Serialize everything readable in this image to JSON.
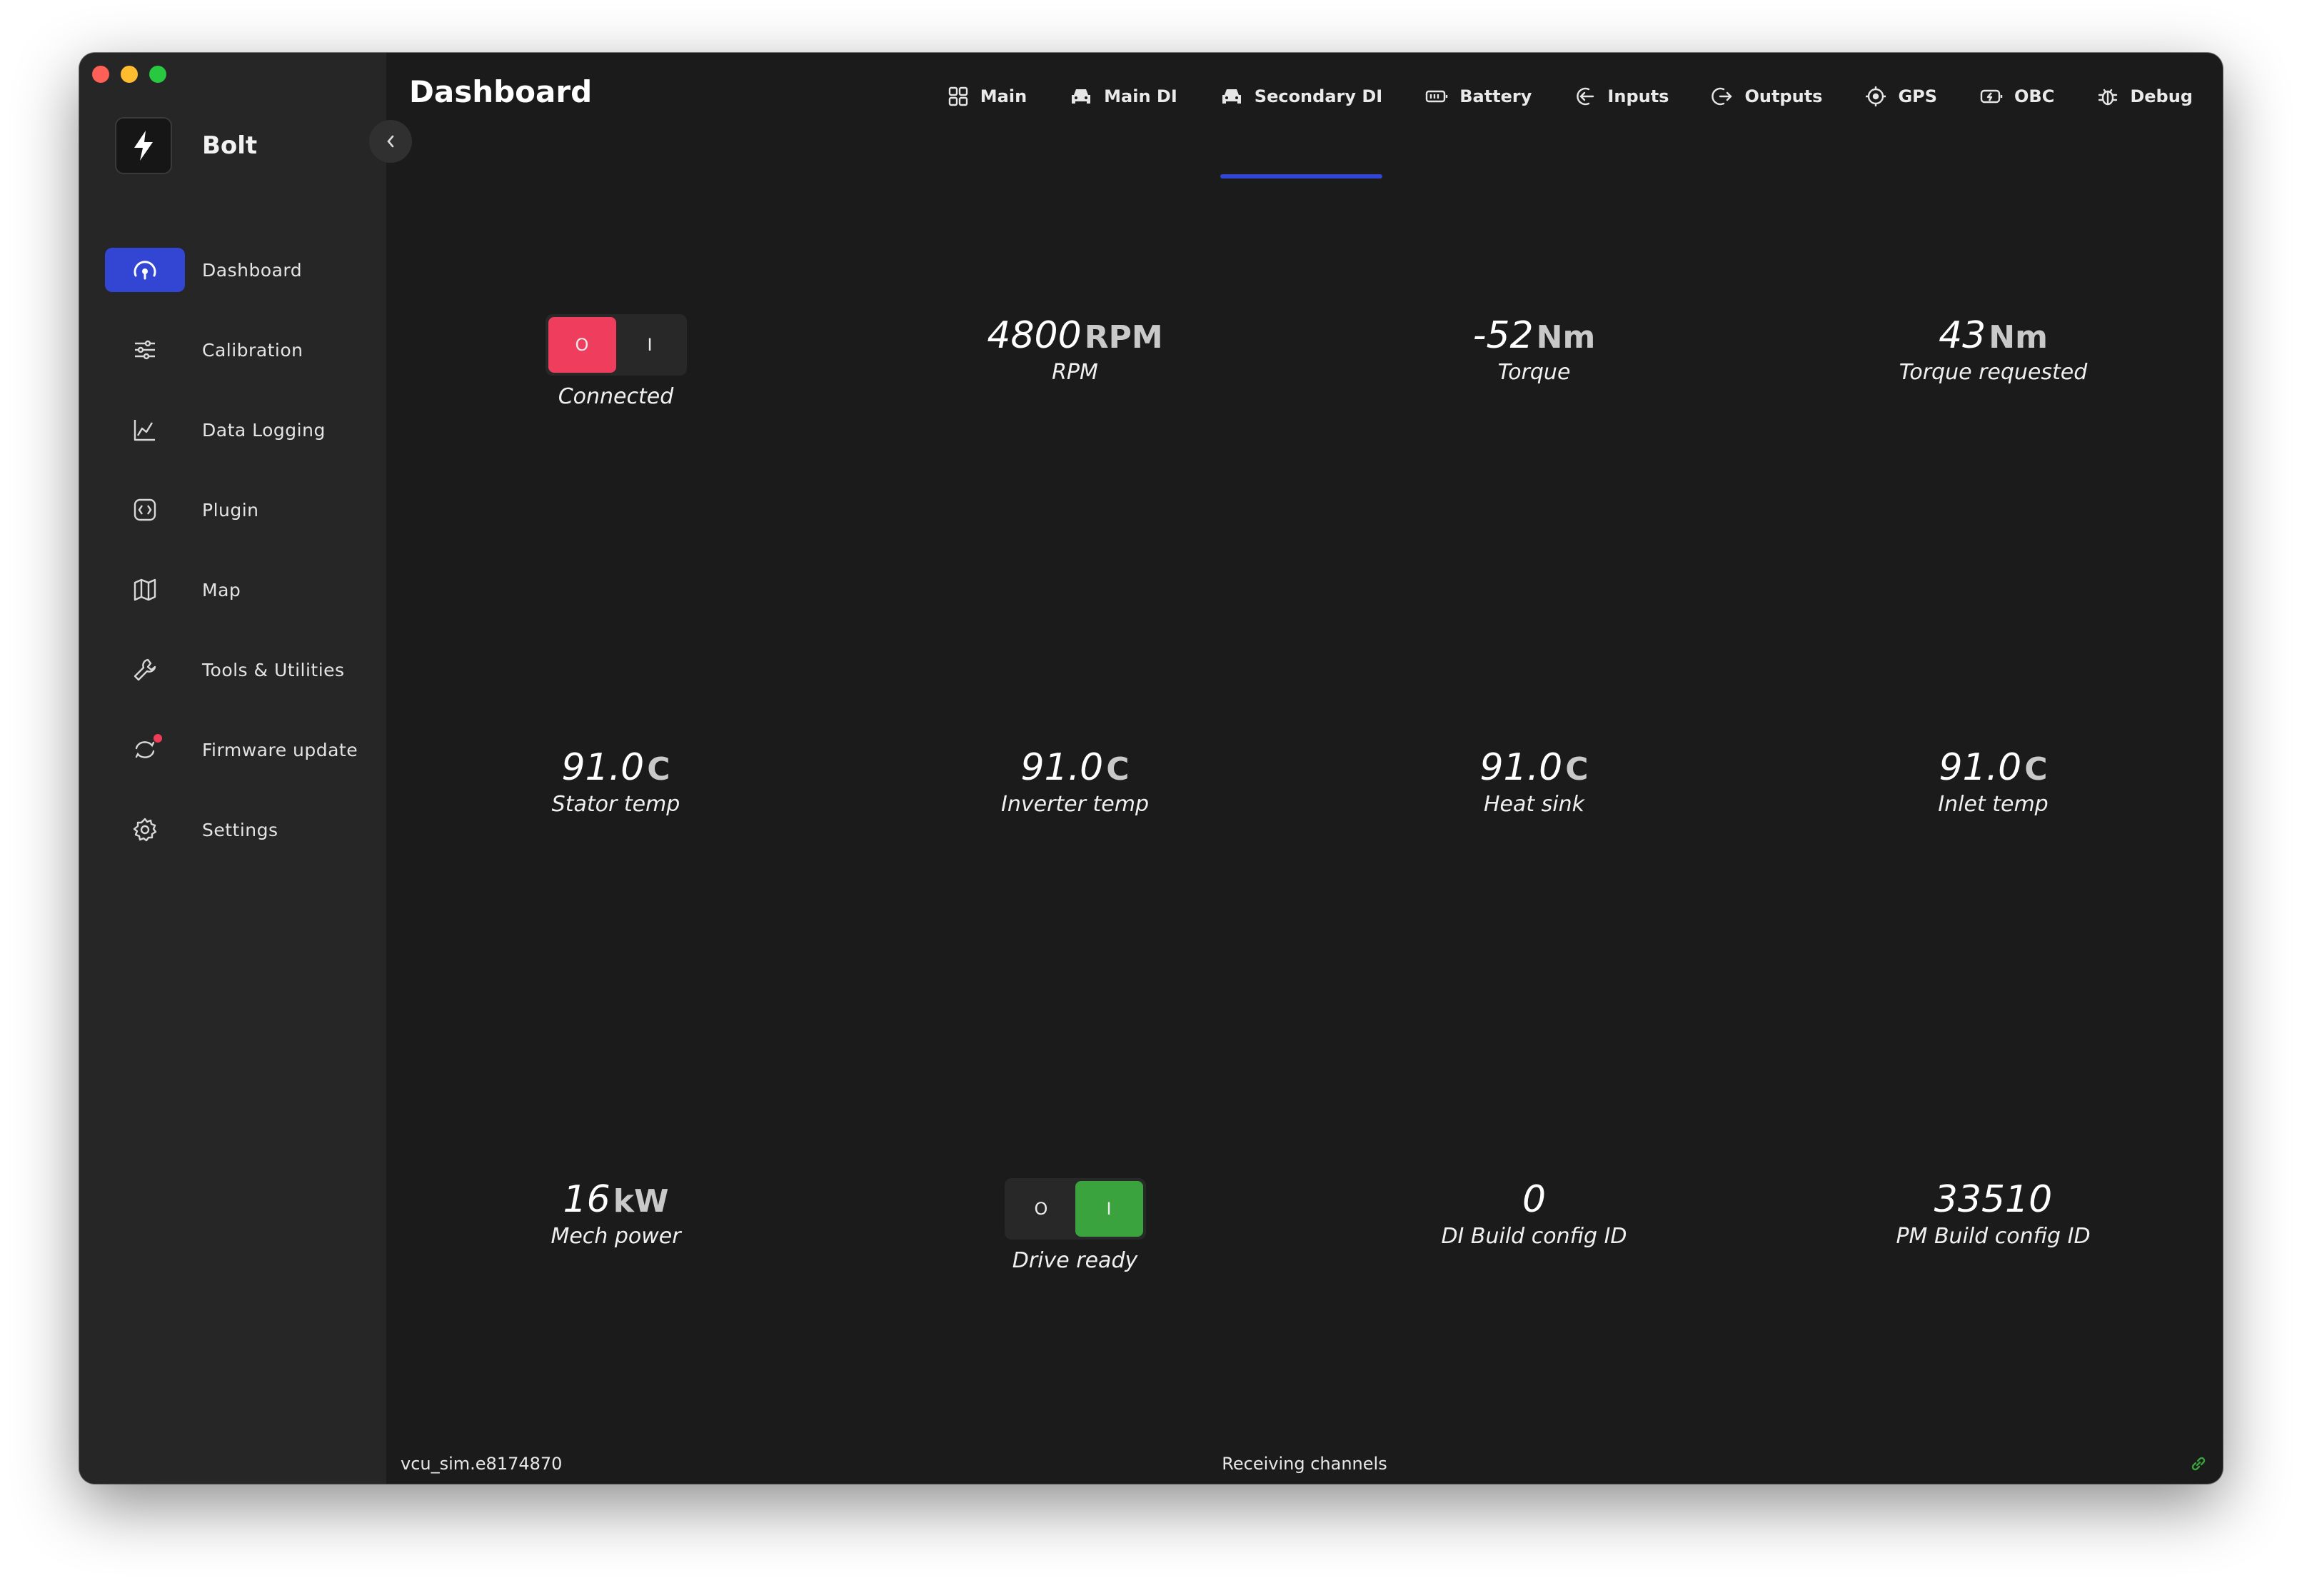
{
  "sidebar": {
    "brand": "Bolt",
    "items": [
      {
        "label": "Dashboard",
        "icon": "gauge-icon",
        "active": true
      },
      {
        "label": "Calibration",
        "icon": "sliders-icon"
      },
      {
        "label": "Data Logging",
        "icon": "chart-line-icon"
      },
      {
        "label": "Plugin",
        "icon": "plugin-icon"
      },
      {
        "label": "Map",
        "icon": "map-icon"
      },
      {
        "label": "Tools & Utilities",
        "icon": "wrench-icon"
      },
      {
        "label": "Firmware update",
        "icon": "refresh-icon",
        "badge": true
      },
      {
        "label": "Settings",
        "icon": "gear-icon"
      }
    ]
  },
  "header": {
    "title": "Dashboard",
    "tabs": [
      {
        "label": "Main",
        "icon": "grid-icon"
      },
      {
        "label": "Main DI",
        "icon": "car-icon"
      },
      {
        "label": "Secondary DI",
        "icon": "car-icon",
        "active": true
      },
      {
        "label": "Battery",
        "icon": "battery-icon"
      },
      {
        "label": "Inputs",
        "icon": "input-icon"
      },
      {
        "label": "Outputs",
        "icon": "output-icon"
      },
      {
        "label": "GPS",
        "icon": "target-icon"
      },
      {
        "label": "OBC",
        "icon": "charger-icon"
      },
      {
        "label": "Debug",
        "icon": "bug-icon"
      }
    ]
  },
  "dashboard": {
    "connected": {
      "label": "Connected",
      "off": "O",
      "on": "I",
      "state": "off"
    },
    "rpm": {
      "value": "4800",
      "unit": "RPM",
      "label": "RPM"
    },
    "torque": {
      "value": "-52",
      "unit": "Nm",
      "label": "Torque"
    },
    "torque_requested": {
      "value": "43",
      "unit": "Nm",
      "label": "Torque requested"
    },
    "stator_temp": {
      "value": "91.0",
      "unit": "C",
      "label": "Stator temp"
    },
    "inverter_temp": {
      "value": "91.0",
      "unit": "C",
      "label": "Inverter temp"
    },
    "heat_sink": {
      "value": "91.0",
      "unit": "C",
      "label": "Heat sink"
    },
    "inlet_temp": {
      "value": "91.0",
      "unit": "C",
      "label": "Inlet temp"
    },
    "mech_power": {
      "value": "16",
      "unit": "kW",
      "label": "Mech power"
    },
    "drive_ready": {
      "label": "Drive ready",
      "off": "O",
      "on": "I",
      "state": "on"
    },
    "di_build": {
      "value": "0",
      "label": "DI Build config ID"
    },
    "pm_build": {
      "value": "33510",
      "label": "PM Build config ID"
    }
  },
  "status": {
    "device": "vcu_sim.e8174870",
    "message": "Receiving channels",
    "link_icon": "link-icon",
    "link_color": "#3aa33e"
  },
  "colors": {
    "accent": "#3346d3",
    "off_red": "#ee3d5d",
    "on_green": "#3aa33e"
  }
}
